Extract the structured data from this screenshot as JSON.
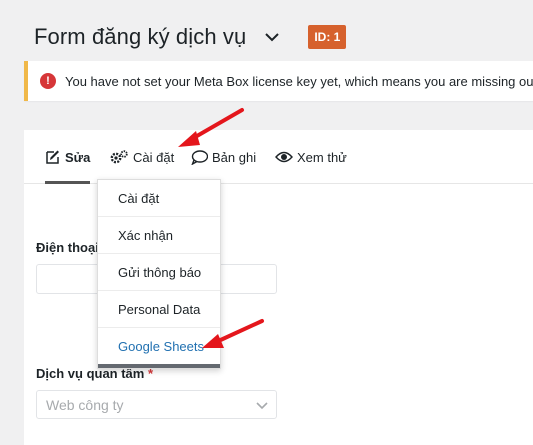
{
  "header": {
    "title": "Form đăng ký dịch vụ",
    "id_badge": "ID: 1",
    "accent_color": "#d6612d"
  },
  "notice": {
    "text": "You have not set your Meta Box license key yet, which means you are missing out",
    "icon": "exclamation-icon"
  },
  "tabs": [
    {
      "label": "Sửa",
      "icon": "pencil-icon",
      "active": true
    },
    {
      "label": "Cài đặt",
      "icon": "gears-icon"
    },
    {
      "label": "Bản ghi",
      "icon": "speech-bubble-icon"
    },
    {
      "label": "Xem thử",
      "icon": "eye-icon"
    }
  ],
  "dropdown": {
    "items": [
      "Cài đặt",
      "Xác nhận",
      "Gửi thông báo",
      "Personal Data",
      "Google Sheets"
    ]
  },
  "fields": {
    "phone_label": "Điện thoại",
    "service_label": "Dịch vụ quan tâm",
    "required_mark": "*",
    "service_value": "Web công ty"
  }
}
